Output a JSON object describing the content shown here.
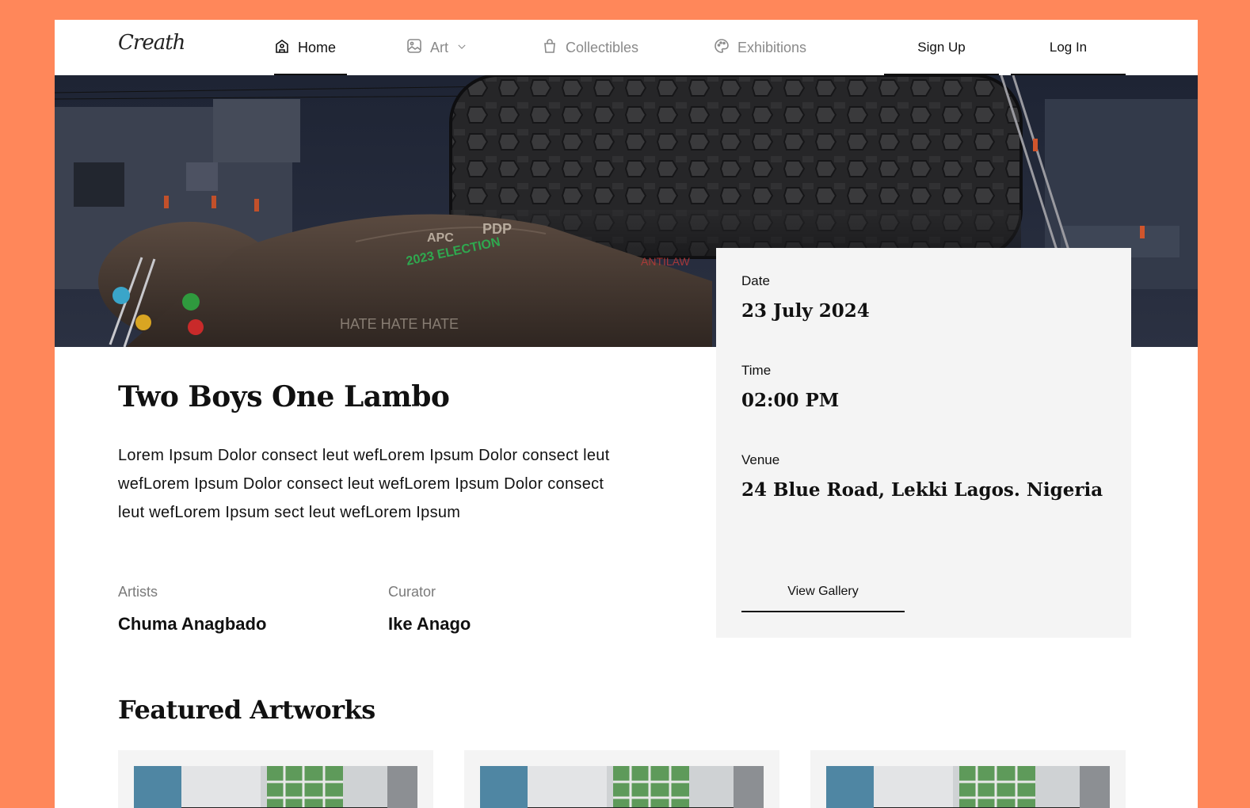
{
  "brand": {
    "logo_text": "Creath"
  },
  "nav": {
    "items": [
      {
        "label": "Home",
        "icon": "gallery-home-icon",
        "active": true
      },
      {
        "label": "Art",
        "icon": "image-icon",
        "dropdown": true
      },
      {
        "label": "Collectibles",
        "icon": "shopping-bag-icon"
      },
      {
        "label": "Exhibitions",
        "icon": "palette-icon"
      }
    ],
    "signup_label": "Sign Up",
    "login_label": "Log In"
  },
  "exhibition": {
    "title": "Two Boys One Lambo",
    "description": "Lorem Ipsum Dolor consect leut wefLorem Ipsum Dolor consect leut wefLorem Ipsum Dolor consect leut wefLorem Ipsum Dolor consect leut wefLorem Ipsum sect leut wefLorem Ipsum",
    "artists_label": "Artists",
    "artists_value": "Chuma Anagbado",
    "curator_label": "Curator",
    "curator_value": "Ike Anago"
  },
  "details": {
    "date_label": "Date",
    "date_value": "23 July 2024",
    "time_label": "Time",
    "time_value": "02:00 PM",
    "venue_label": "Venue",
    "venue_value": "24 Blue Road, Lekki Lagos. Nigeria",
    "gallery_button": "View Gallery"
  },
  "featured": {
    "heading": "Featured Artworks"
  },
  "colors": {
    "background": "#FF875A",
    "accent": "#111111",
    "card": "#F4F4F4"
  }
}
